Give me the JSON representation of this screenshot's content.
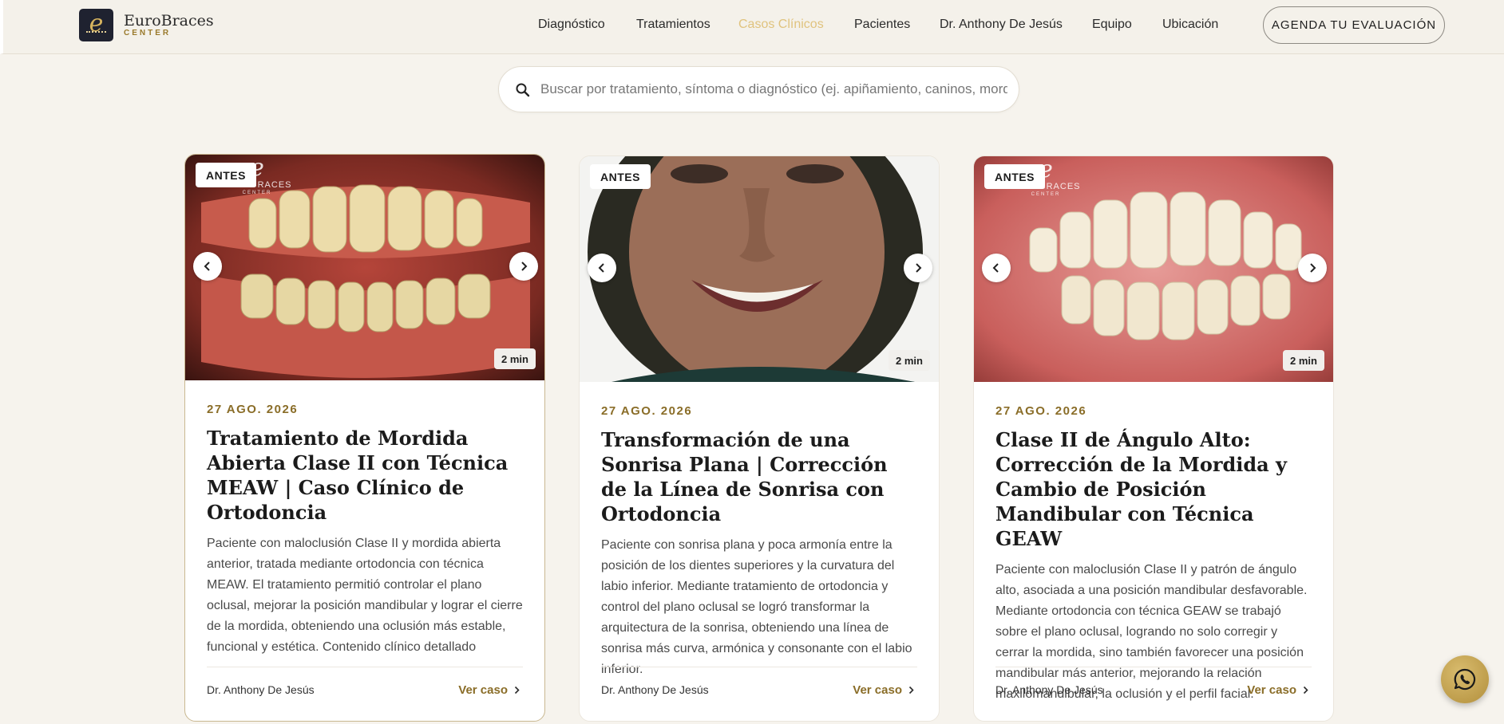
{
  "brand": {
    "name": "EuroBraces",
    "sub": "CENTER",
    "gold": "#d7b45f"
  },
  "nav": {
    "items": [
      {
        "label": "Diagnóstico",
        "active": false
      },
      {
        "label": "Tratamientos",
        "active": false
      },
      {
        "label": "Casos Clínicos",
        "active": true
      },
      {
        "label": "Pacientes",
        "active": false
      },
      {
        "label": "Dr. Anthony De Jesús",
        "active": false
      },
      {
        "label": "Equipo",
        "active": false
      },
      {
        "label": "Ubicación",
        "active": false
      }
    ],
    "cta_label": "AGENDA TU EVALUACIÓN",
    "active_color": "#e0c37e"
  },
  "search": {
    "placeholder": "Buscar por tratamiento, síntoma o diagnóstico (ej. apiñamiento, caninos, mordida...)",
    "icon": "search-icon"
  },
  "cards": [
    {
      "badge": "ANTES",
      "read_time": "2 min",
      "date": "27 AGO. 2026",
      "title": "Tratamiento de Mordida Abierta Clase II con Técnica MEAW | Caso Clínico de Ortodoncia",
      "excerpt": "Paciente con maloclusión Clase II y mordida abierta anterior, tratada mediante ortodoncia con técnica MEAW. El tratamiento permitió controlar el plano oclusal, mejorar la posición mandibular y lograr el cierre de la mordida, obteniendo una oclusión más estable, funcional y estética. Contenido clínico detallado",
      "author": "Dr. Anthony De Jesús",
      "link_label": "Ver caso",
      "watermark": {
        "name": "EUROBRACES",
        "sub": "CENTER"
      }
    },
    {
      "badge": "ANTES",
      "read_time": "2 min",
      "date": "27 AGO. 2026",
      "title": "Transformación de una Sonrisa Plana | Corrección de la Línea de Sonrisa con Ortodoncia",
      "excerpt": "Paciente con sonrisa plana y poca armonía entre la posición de los dientes superiores y la curvatura del labio inferior. Mediante tratamiento de ortodoncia y control del plano oclusal se logró transformar la arquitectura de la sonrisa, obteniendo una línea de sonrisa más curva, armónica y consonante con el labio inferior.",
      "author": "Dr. Anthony De Jesús",
      "link_label": "Ver caso"
    },
    {
      "badge": "ANTES",
      "read_time": "2 min",
      "date": "27 AGO. 2026",
      "title": "Clase II de Ángulo Alto: Corrección de la Mordida y Cambio de Posición Mandibular con Técnica GEAW",
      "excerpt": "Paciente con maloclusión Clase II y patrón de ángulo alto, asociada a una posición mandibular desfavorable. Mediante ortodoncia con técnica GEAW se trabajó sobre el plano oclusal, logrando no solo corregir y cerrar la mordida, sino también favorecer una posición mandibular más anterior, mejorando la relación maxilomandibular, la oclusión y el perfil facial.",
      "author": "Dr. Anthony De Jesús",
      "link_label": "Ver caso",
      "watermark": {
        "name": "EUROBRACES",
        "sub": "CENTER"
      }
    }
  ],
  "chat": {
    "icon": "whatsapp-icon"
  }
}
